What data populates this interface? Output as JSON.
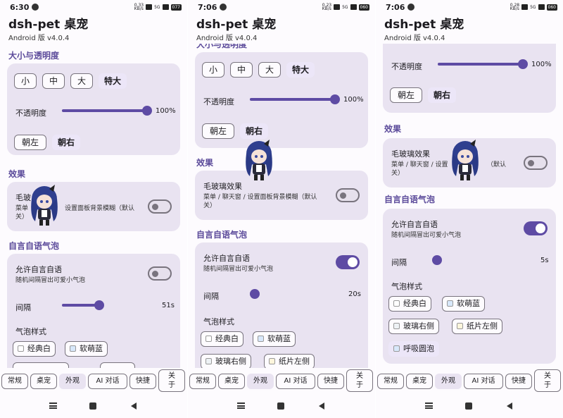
{
  "screens": [
    {
      "status": {
        "time": "6:30",
        "speed": "0.33\nKB/s",
        "signal": "5G",
        "battery": "077"
      },
      "app_title": "dsh-pet 桌宠",
      "app_version": "Android 版 v4.0.4",
      "sections": {
        "size": "大小与透明度",
        "effects": "效果",
        "bubble": "自言自语气泡"
      },
      "size_buttons": [
        "小",
        "中",
        "大"
      ],
      "size_selected": "特大",
      "opacity_label": "不透明度",
      "opacity_value": "100%",
      "opacity_level": 1.0,
      "facing_button": "朝左",
      "facing_selected": "朝右",
      "glass_label": "毛玻",
      "glass_desc_left": "菜单",
      "glass_desc_right": "设置面板背景模糊（默认",
      "glass_desc_line2": "关）",
      "glass_on": false,
      "talk_label": "允许自言自语",
      "talk_desc": "随机间隔冒出可爱小气泡",
      "talk_on": false,
      "interval_label": "间隔",
      "interval_value": "51s",
      "interval_level": 0.1,
      "bubble_style_label": "气泡样式",
      "bubble_styles": [
        "经典白",
        "软萌蓝"
      ]
    },
    {
      "status": {
        "time": "7:06",
        "speed": "0.23\nKB/s",
        "signal": "5G",
        "battery": "060"
      },
      "app_title": "dsh-pet 桌宠",
      "app_version": "Android 版 v4.0.4",
      "sections": {
        "size": "大小与透明度",
        "effects": "效果",
        "bubble": "自言自语气泡"
      },
      "size_buttons": [
        "小",
        "中",
        "大"
      ],
      "size_selected": "特大",
      "opacity_label": "不透明度",
      "opacity_value": "100%",
      "opacity_level": 1.0,
      "facing_button": "朝左",
      "facing_selected": "朝右",
      "glass_label": "毛玻璃效果",
      "glass_desc": "菜单 / 聊天窗 / 设置面板背景模糊（默认",
      "glass_desc_line2": "关）",
      "glass_on": false,
      "talk_label": "允许自言自语",
      "talk_desc": "随机间隔冒出可爱小气泡",
      "talk_on": true,
      "interval_label": "间隔",
      "interval_value": "20s",
      "interval_level": 0.0,
      "bubble_style_label": "气泡样式",
      "bubble_styles": [
        "经典白",
        "软萌蓝",
        "玻璃右侧",
        "纸片左侧"
      ]
    },
    {
      "status": {
        "time": "7:06",
        "speed": "0.28\nKB/s",
        "signal": "5G",
        "battery": "060"
      },
      "app_title": "dsh-pet 桌宠",
      "app_version": "Android 版 v4.0.4",
      "sections": {
        "effects": "效果",
        "bubble": "自言自语气泡"
      },
      "opacity_label": "不透明度",
      "opacity_value": "100%",
      "opacity_level": 1.0,
      "facing_button": "朝左",
      "facing_selected": "朝右",
      "glass_label": "毛玻璃效果",
      "glass_desc": "菜单 / 聊天窗 / 设置",
      "glass_desc_right": "（默认",
      "glass_desc_line2": "关）",
      "glass_on": false,
      "talk_label": "允许自言自语",
      "talk_desc": "随机间隔冒出可爱小气泡",
      "talk_on": true,
      "interval_label": "间隔",
      "interval_value": "5s",
      "interval_level": 0.0,
      "bubble_style_label": "气泡样式",
      "bubble_styles": [
        "经典白",
        "软萌蓝",
        "玻璃右侧",
        "纸片左侧",
        "呼吸圆泡"
      ]
    }
  ],
  "tabs": [
    "常规",
    "桌宠",
    "外观",
    "AI 对话",
    "快捷",
    "关\n于"
  ],
  "active_tab": "外观",
  "colors": {
    "accent": "#5e4ba4",
    "section_title": "#5b4a9a",
    "card": "#e9e3f1",
    "background": "#fdfbfe"
  },
  "icons": [
    "settings-small-icon",
    "wifi-icon",
    "signal-icon",
    "battery-icon",
    "nav-menu-icon",
    "nav-home-icon",
    "nav-back-icon"
  ]
}
